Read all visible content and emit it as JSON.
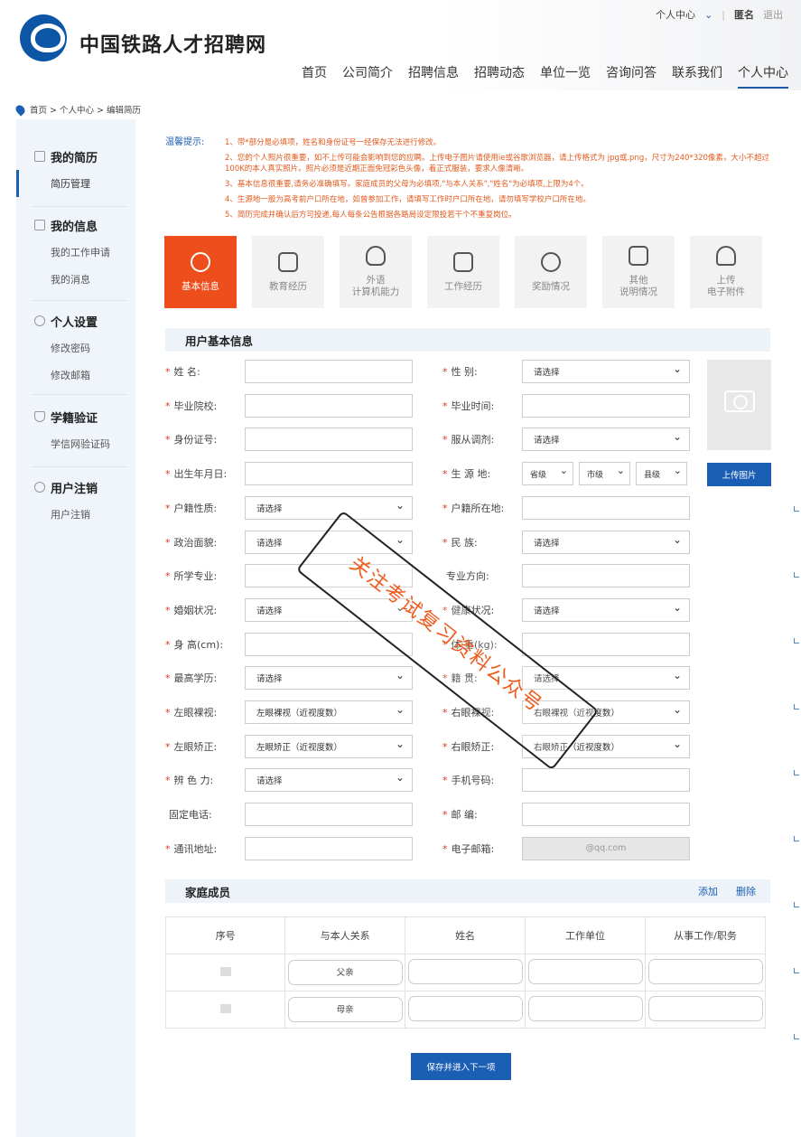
{
  "brand": "中国铁路人才招聘网",
  "userlinks": {
    "center": "个人中心",
    "name": "匿名",
    "logout": "退出"
  },
  "nav": [
    "首页",
    "公司简介",
    "招聘信息",
    "招聘动态",
    "单位一览",
    "咨询问答",
    "联系我们",
    "个人中心"
  ],
  "breadcrumb": "首页 > 个人中心 > 编辑简历",
  "sidebar": {
    "resume": {
      "title": "我的简历",
      "items": [
        "简历管理"
      ]
    },
    "info": {
      "title": "我的信息",
      "items": [
        "我的工作申请",
        "我的消息"
      ]
    },
    "settings": {
      "title": "个人设置",
      "items": [
        "修改密码",
        "修改邮箱"
      ]
    },
    "verify": {
      "title": "学籍验证",
      "items": [
        "学信网验证码"
      ]
    },
    "cancel": {
      "title": "用户注销",
      "items": [
        "用户注销"
      ]
    }
  },
  "tips": {
    "label": "温馨提示:",
    "items": [
      "1、带*部分是必填项，姓名和身份证号一经保存无法进行修改。",
      "2、您的个人照片很重要，如不上传可能会影响到您的应聘。上传电子图片请使用ie或谷歌浏览器，请上传格式为 jpg或.png，尺寸为240*320像素，大小不超过100K的本人真实照片。照片必须是近期正面免冠彩色头像，着正式服装，要求人像清晰。",
      "3、基本信息很重要,请务必准确填写。家庭成员的父母为必填项,\"与本人关系\",\"姓名\"为必填项,上限为4个。",
      "4、生源地一般为高考前户口所在地，如曾参加工作，请填写工作时户口所在地，请勿填写学校户口所在地。",
      "5、简历完成并确认后方可投递,每人每条公告根据各路局设定限投若干个不重复岗位。"
    ]
  },
  "tabs": [
    "基本信息",
    "教育经历",
    "外语\n计算机能力",
    "工作经历",
    "奖励情况",
    "其他\n说明情况",
    "上传\n电子附件"
  ],
  "section_basic": "用户基本信息",
  "fields_left": [
    {
      "label": "姓    名:",
      "req": "*",
      "value": "",
      "type": "text"
    },
    {
      "label": "毕业院校:",
      "req": "*",
      "value": "",
      "type": "text"
    },
    {
      "label": "身份证号:",
      "req": "*",
      "value": "",
      "type": "text"
    },
    {
      "label": "出生年月日:",
      "req": "*",
      "value": "",
      "type": "text"
    },
    {
      "label": "户籍性质:",
      "req": "*",
      "value": "请选择",
      "type": "select"
    },
    {
      "label": "政治面貌:",
      "req": "*",
      "value": "请选择",
      "type": "select"
    },
    {
      "label": "所学专业:",
      "req": "*",
      "value": "",
      "type": "text"
    },
    {
      "label": "婚姻状况:",
      "req": "*",
      "value": "请选择",
      "type": "select"
    },
    {
      "label": "身 高(cm):",
      "req": "*",
      "value": "",
      "type": "text"
    },
    {
      "label": "最高学历:",
      "req": "*",
      "value": "请选择",
      "type": "select"
    },
    {
      "label": "左眼裸视:",
      "req": "*",
      "value": "左眼裸视（近视度数）",
      "type": "select"
    },
    {
      "label": "左眼矫正:",
      "req": "*",
      "value": "左眼矫正（近视度数）",
      "type": "select"
    },
    {
      "label": "辨 色 力:",
      "req": "*",
      "value": "请选择",
      "type": "select"
    },
    {
      "label": "固定电话:",
      "req": "",
      "value": "",
      "type": "text"
    },
    {
      "label": "通讯地址:",
      "req": "*",
      "value": "",
      "type": "text"
    }
  ],
  "fields_right": [
    {
      "label": "性    别:",
      "req": "*",
      "value": "请选择",
      "type": "select"
    },
    {
      "label": "毕业时间:",
      "req": "*",
      "value": "",
      "type": "date"
    },
    {
      "label": "服从调剂:",
      "req": "*",
      "value": "请选择",
      "type": "select"
    },
    {
      "label": "生 源 地:",
      "req": "*",
      "value": "",
      "type": "region"
    },
    {
      "label": "户籍所在地:",
      "req": "*",
      "value": "",
      "type": "text"
    },
    {
      "label": "民    族:",
      "req": "*",
      "value": "请选择",
      "type": "select"
    },
    {
      "label": "专业方向:",
      "req": "",
      "value": "",
      "type": "text"
    },
    {
      "label": "健康状况:",
      "req": "*",
      "value": "请选择",
      "type": "select"
    },
    {
      "label": "体 重(kg):",
      "req": "*",
      "value": "",
      "type": "text"
    },
    {
      "label": "籍    贯:",
      "req": "*",
      "value": "请选择",
      "type": "select"
    },
    {
      "label": "右眼裸视:",
      "req": "*",
      "value": "右眼裸视（近视度数）",
      "type": "select"
    },
    {
      "label": "右眼矫正:",
      "req": "*",
      "value": "右眼矫正（近视度数）",
      "type": "select"
    },
    {
      "label": "手机号码:",
      "req": "*",
      "value": "",
      "type": "text"
    },
    {
      "label": "邮    编:",
      "req": "*",
      "value": "",
      "type": "text"
    },
    {
      "label": "电子邮箱:",
      "req": "*",
      "value": "@qq.com",
      "type": "grey"
    }
  ],
  "region": [
    "省级",
    "市级",
    "县级"
  ],
  "upload_photo": "上传图片",
  "section_family": "家庭成员",
  "family_actions": {
    "add": "添加",
    "delete": "删除"
  },
  "family_headers": [
    "序号",
    "与本人关系",
    "姓名",
    "工作单位",
    "从事工作/职务"
  ],
  "family_rows": [
    {
      "relation": "父亲"
    },
    {
      "relation": "母亲"
    }
  ],
  "save_button": "保存并进入下一项",
  "watermark": "关注考试复习资料公众号"
}
